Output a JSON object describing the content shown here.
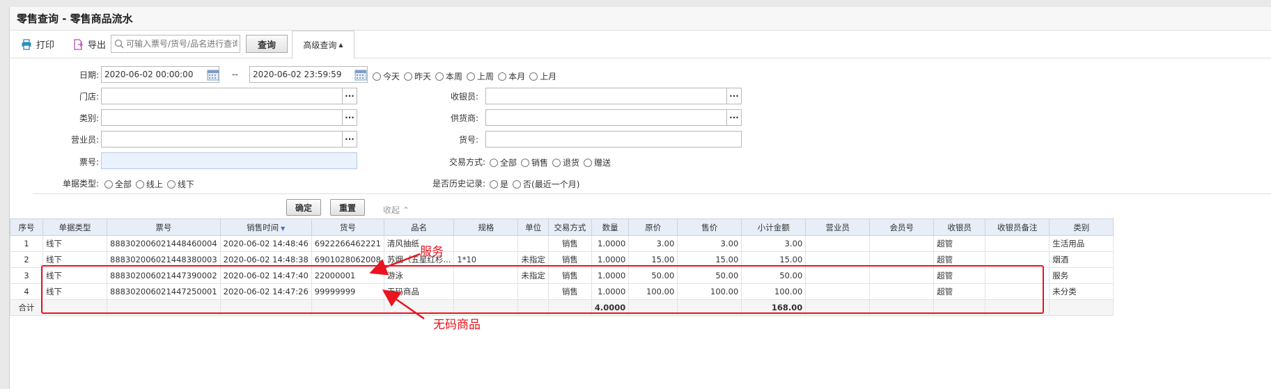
{
  "window": {
    "title": "零售查询 - 零售商品流水"
  },
  "toolbar": {
    "print_label": "打印",
    "export_label": "导出",
    "search_placeholder": "可输入票号/货号/品名进行查询",
    "query_label": "查询",
    "advanced_label": "高级查询"
  },
  "form": {
    "date_label": "日期:",
    "date_from": "2020-06-02 00:00:00",
    "date_sep": "--",
    "date_to": "2020-06-02 23:59:59",
    "date_quick": [
      "今天",
      "昨天",
      "本周",
      "上周",
      "本月",
      "上月"
    ],
    "store_label": "门店:",
    "category_label": "类别:",
    "salesperson_label": "营业员:",
    "ticket_label": "票号:",
    "doc_type_label": "单据类型:",
    "doc_type_options": [
      "全部",
      "线上",
      "线下"
    ],
    "cashier_label": "收银员:",
    "supplier_label": "供货商:",
    "item_no_label": "货号:",
    "trade_mode_label": "交易方式:",
    "trade_mode_options": [
      "全部",
      "销售",
      "退货",
      "赠送"
    ],
    "history_label": "是否历史记录:",
    "history_options": [
      "是",
      "否(最近一个月)"
    ],
    "confirm_label": "确定",
    "reset_label": "重置",
    "collapse_label": "收起"
  },
  "table": {
    "headers": [
      "序号",
      "单据类型",
      "票号",
      "销售时间",
      "货号",
      "品名",
      "规格",
      "单位",
      "交易方式",
      "数量",
      "原价",
      "售价",
      "小计金额",
      "营业员",
      "会员号",
      "收银员",
      "收银员备注",
      "类别"
    ],
    "rows": [
      [
        "1",
        "线下",
        "888302006021448460004",
        "2020-06-02 14:48:46",
        "6922266462221",
        "清风抽纸",
        "",
        "",
        "销售",
        "1.0000",
        "3.00",
        "3.00",
        "3.00",
        "",
        "",
        "超管",
        "",
        "生活用品"
      ],
      [
        "2",
        "线下",
        "888302006021448380003",
        "2020-06-02 14:48:38",
        "6901028062008",
        "苏烟（五星红杉...",
        "1*10",
        "未指定",
        "销售",
        "1.0000",
        "15.00",
        "15.00",
        "15.00",
        "",
        "",
        "超管",
        "",
        "烟酒"
      ],
      [
        "3",
        "线下",
        "888302006021447390002",
        "2020-06-02 14:47:40",
        "22000001",
        "游泳",
        "",
        "未指定",
        "销售",
        "1.0000",
        "50.00",
        "50.00",
        "50.00",
        "",
        "",
        "超管",
        "",
        "服务"
      ],
      [
        "4",
        "线下",
        "888302006021447250001",
        "2020-06-02 14:47:26",
        "99999999",
        "无码商品",
        "",
        "",
        "销售",
        "1.0000",
        "100.00",
        "100.00",
        "100.00",
        "",
        "",
        "超管",
        "",
        "未分类"
      ]
    ],
    "total_label": "合计",
    "total_qty": "4.0000",
    "total_amount": "168.00"
  },
  "annotations": {
    "service": "服务",
    "no_code": "无码商品",
    "color": "#e8141e"
  }
}
